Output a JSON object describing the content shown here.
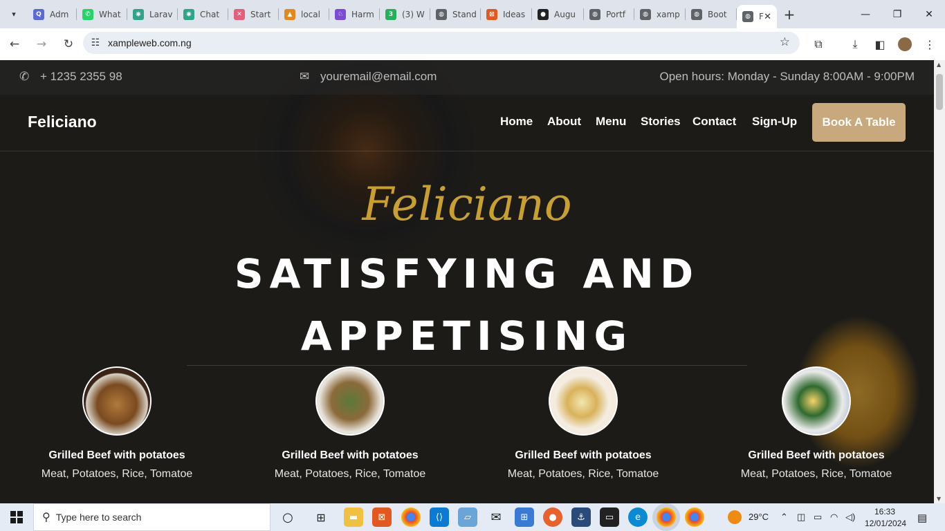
{
  "browser": {
    "tabs": [
      {
        "label": "Adm",
        "color": "#5a6bd6",
        "glyph": "Q"
      },
      {
        "label": "What",
        "color": "#25d366",
        "glyph": "✆"
      },
      {
        "label": "Larav",
        "color": "#2ea48a",
        "glyph": "⎈"
      },
      {
        "label": "Chat",
        "color": "#2ea48a",
        "glyph": "⎈"
      },
      {
        "label": "Start",
        "color": "#e35f7a",
        "glyph": "✕"
      },
      {
        "label": "local",
        "color": "#e08a1e",
        "glyph": "▲"
      },
      {
        "label": "Harm",
        "color": "#7b4bd6",
        "glyph": "♘"
      },
      {
        "label": "(3) W",
        "color": "#25b05a",
        "glyph": "3"
      },
      {
        "label": "Stand",
        "color": "#5f6368",
        "glyph": "◍"
      },
      {
        "label": "Ideas",
        "color": "#e2581f",
        "glyph": "⊠"
      },
      {
        "label": "Augu",
        "color": "#222222",
        "glyph": "●"
      },
      {
        "label": "Portf",
        "color": "#5f6368",
        "glyph": "◍"
      },
      {
        "label": "xamp",
        "color": "#5f6368",
        "glyph": "◍"
      },
      {
        "label": "Boot",
        "color": "#5f6368",
        "glyph": "◍"
      },
      {
        "label": "F",
        "color": "#5f6368",
        "glyph": "◍"
      }
    ],
    "new_tab": "+",
    "url": "xampleweb.com.ng"
  },
  "site": {
    "phone": "+ 1235 2355 98",
    "email": "youremail@email.com",
    "hours": "Open hours: Monday - Sunday 8:00AM - 9:00PM",
    "brand": "Feliciano",
    "nav": [
      "Home",
      "About",
      "Menu",
      "Stories",
      "Contact",
      "Sign-Up"
    ],
    "cta": "Book A Table",
    "hero_script": "Feliciano",
    "hero_line1": "SATISFYING AND",
    "hero_line2": "APPETISING",
    "dishes": [
      {
        "title": "Grilled Beef with potatoes",
        "desc": "Meat, Potatoes, Rice, Tomatoe"
      },
      {
        "title": "Grilled Beef with potatoes",
        "desc": "Meat, Potatoes, Rice, Tomatoe"
      },
      {
        "title": "Grilled Beef with potatoes",
        "desc": "Meat, Potatoes, Rice, Tomatoe"
      },
      {
        "title": "Grilled Beef with potatoes",
        "desc": "Meat, Potatoes, Rice, Tomatoe"
      }
    ]
  },
  "taskbar": {
    "search_placeholder": "Type here to search",
    "temperature": "29°C",
    "time": "16:33",
    "date": "12/01/2024"
  },
  "colors": {
    "gold": "#c8a030",
    "cta": "#c8a97e"
  }
}
